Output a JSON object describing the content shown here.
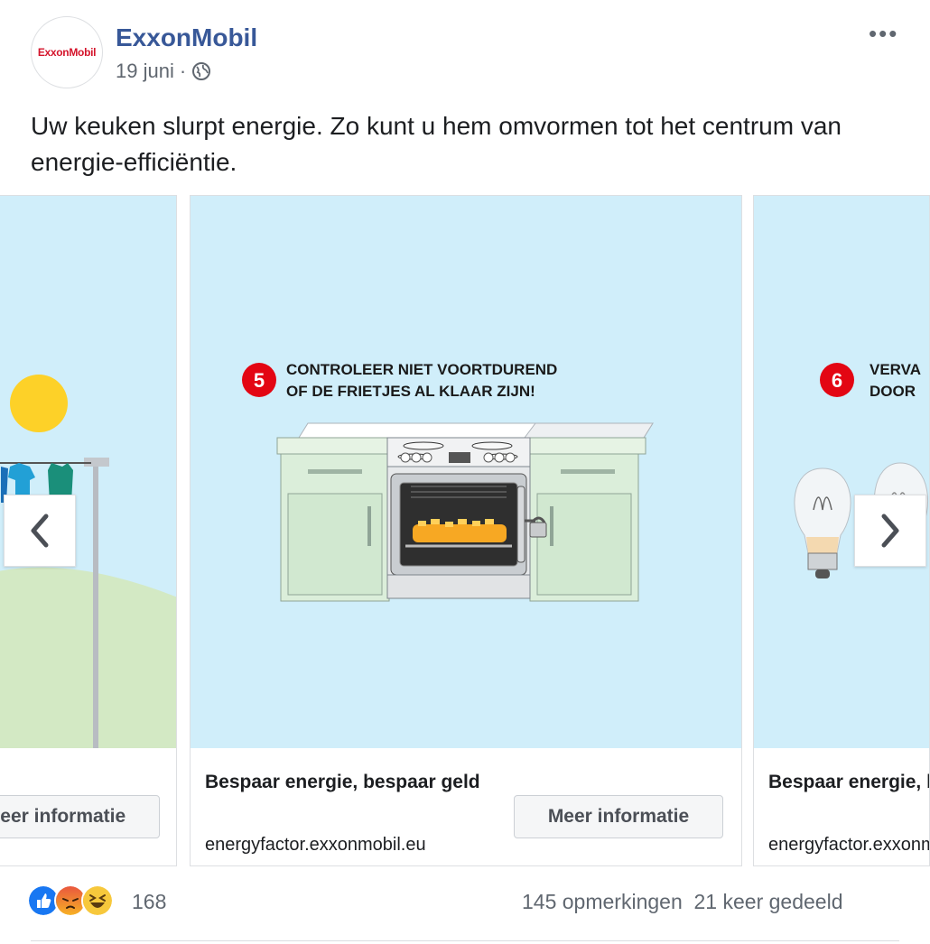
{
  "post": {
    "author": "ExxonMobil",
    "avatar_text": "ExxonMobil",
    "date": "19 juni",
    "separator": "·",
    "more_label": "•••",
    "caption": "Uw keuken slurpt energie. Zo kunt u hem omvormen tot het centrum van energie-efficiëntie."
  },
  "carousel": {
    "cards": [
      {
        "button": "Meer informatie"
      },
      {
        "step": "5",
        "step_line1": "CONTROLEER NIET VOORTDUREND",
        "step_line2": "OF DE FRIETJES AL KLAAR ZIJN!",
        "title": "Bespaar energie, bespaar geld",
        "url": "energyfactor.exxonmobil.eu",
        "button": "Meer informatie"
      },
      {
        "step": "6",
        "step_line1": "VERVA",
        "step_line2": "DOOR",
        "title": "Bespaar energie, bespaar geld",
        "url": "energyfactor.exxonmobil.eu"
      }
    ]
  },
  "footer": {
    "reactions": [
      "like-icon",
      "angry-icon",
      "haha-icon"
    ],
    "reaction_count": "168",
    "comments": "145 opmerkingen",
    "shares": "21 keer gedeeld"
  },
  "colors": {
    "link": "#385898",
    "brand_red": "#d4142b",
    "sky": "#d0eefa",
    "step_badge": "#e30613"
  }
}
